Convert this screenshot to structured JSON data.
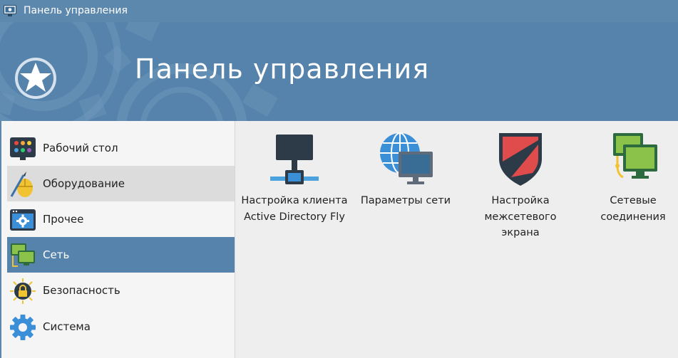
{
  "window": {
    "title": "Панель управления",
    "icon": "control-panel-icon"
  },
  "banner": {
    "title": "Панель управления",
    "icon": "star-gear-icon"
  },
  "sidebar": {
    "items": [
      {
        "label": "Рабочий стол",
        "icon": "desktop-palette-icon",
        "state": "normal"
      },
      {
        "label": "Оборудование",
        "icon": "mouse-pen-icon",
        "state": "hover"
      },
      {
        "label": "Прочее",
        "icon": "window-gear-icon",
        "state": "normal"
      },
      {
        "label": "Сеть",
        "icon": "network-monitors-icon",
        "state": "selected"
      },
      {
        "label": "Безопасность",
        "icon": "lock-icon",
        "state": "normal"
      },
      {
        "label": "Система",
        "icon": "gear-icon",
        "state": "normal"
      }
    ]
  },
  "content": {
    "tiles": [
      {
        "label": "Настройка клиента\nActive Directory Fly",
        "icon": "ad-client-icon"
      },
      {
        "label": "Параметры сети",
        "icon": "globe-monitor-icon"
      },
      {
        "label": "Настройка\nмежсетевого\nэкрана",
        "icon": "firewall-shield-icon"
      },
      {
        "label": "Сетевые\nсоединения",
        "icon": "network-connections-icon"
      }
    ]
  },
  "colors": {
    "titlebar": "#5d88ad",
    "banner": "#5683ac",
    "selected": "#5683ac",
    "hover": "#dcdcdc",
    "sidebar_bg": "#f5f5f5",
    "content_bg": "#eeeeee"
  }
}
